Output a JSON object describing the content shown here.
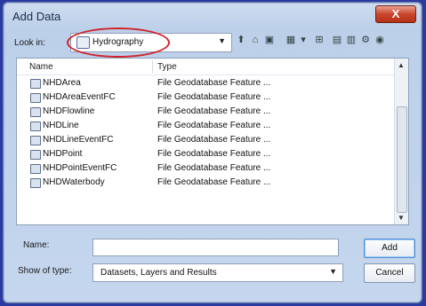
{
  "dialog": {
    "title": "Add Data",
    "close_label": "X",
    "look_in_label": "Look in:",
    "look_in_value": "Hydrography",
    "name_label": "Name:",
    "name_value": "",
    "show_type_label": "Show of type:",
    "show_type_value": "Datasets, Layers and Results",
    "add_label": "Add",
    "cancel_label": "Cancel"
  },
  "toolbar": {
    "icons": [
      "up-level-icon",
      "home-icon",
      "catalog-icon",
      "view-icon",
      "dropdown-icon",
      "connect-folder-icon",
      "new-icon",
      "options-icon",
      "globe-icon"
    ]
  },
  "list": {
    "columns": [
      "Name",
      "Type"
    ],
    "rows": [
      {
        "name": "NHDArea",
        "type": "File Geodatabase Feature ..."
      },
      {
        "name": "NHDAreaEventFC",
        "type": "File Geodatabase Feature ..."
      },
      {
        "name": "NHDFlowline",
        "type": "File Geodatabase Feature ..."
      },
      {
        "name": "NHDLine",
        "type": "File Geodatabase Feature ..."
      },
      {
        "name": "NHDLineEventFC",
        "type": "File Geodatabase Feature ..."
      },
      {
        "name": "NHDPoint",
        "type": "File Geodatabase Feature ..."
      },
      {
        "name": "NHDPointEventFC",
        "type": "File Geodatabase Feature ..."
      },
      {
        "name": "NHDWaterbody",
        "type": "File Geodatabase Feature ..."
      }
    ]
  },
  "colors": {
    "highlight": "#d1232a",
    "background": "#2a3aa0"
  }
}
